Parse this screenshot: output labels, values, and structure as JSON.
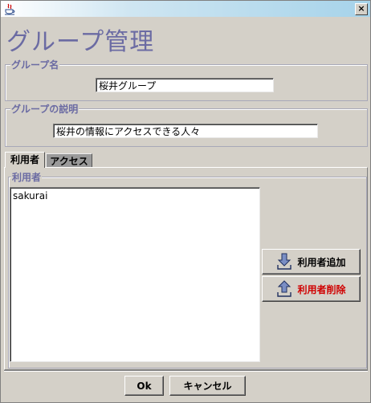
{
  "window": {
    "title": ""
  },
  "header": {
    "title": "グループ管理"
  },
  "group_name": {
    "legend": "グループ名",
    "value": "桜井グループ"
  },
  "group_desc": {
    "legend": "グループの説明",
    "value": "桜井の情報にアクセスできる人々"
  },
  "tabs": [
    {
      "label": "利用者",
      "active": true
    },
    {
      "label": "アクセス",
      "active": false
    }
  ],
  "users_panel": {
    "legend": "利用者",
    "items": [
      "sakurai"
    ],
    "add_label": "利用者追加",
    "remove_label": "利用者削除"
  },
  "footer": {
    "ok_label": "Ok",
    "cancel_label": "キャンセル"
  },
  "colors": {
    "accent": "#6b6ba3",
    "remove_text": "#d00000"
  }
}
